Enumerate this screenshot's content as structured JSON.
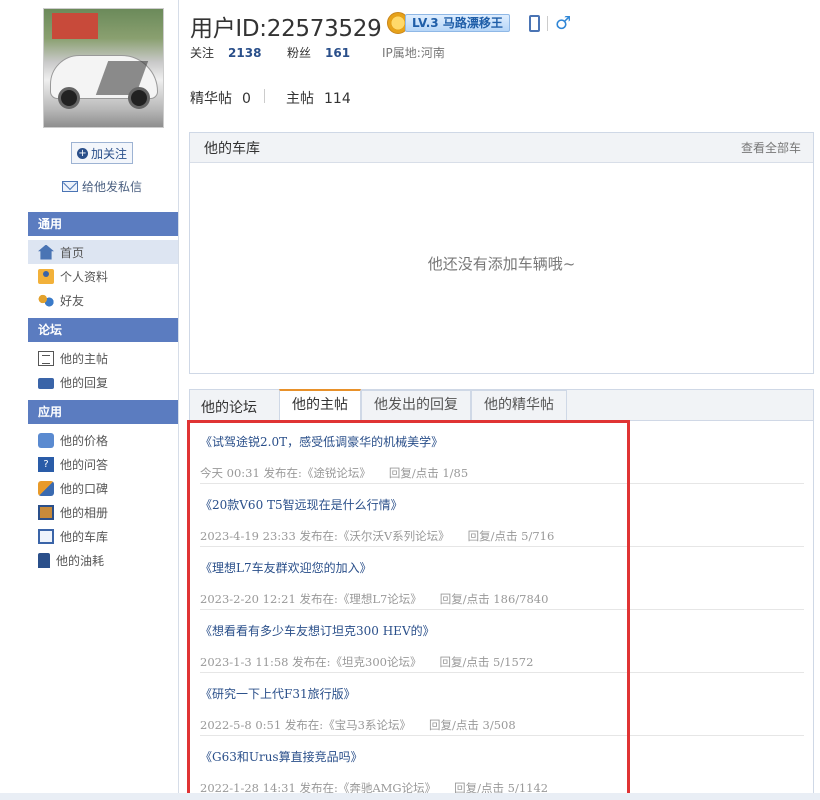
{
  "profile": {
    "title": "用户ID:22573529",
    "level_badge": "LV.3 马路漂移王",
    "follow_label": "关注",
    "follow_count": "2138",
    "fans_label": "粉丝",
    "fans_count": "161",
    "ip_location": "IP属地:河南",
    "essence_label": "精华帖",
    "essence_count": "0",
    "main_label": "主帖",
    "main_count": "114",
    "gender": "male"
  },
  "sidebar": {
    "follow_button": "加关注",
    "message_link": "给他发私信",
    "sections": [
      {
        "title": "通用",
        "items": [
          "首页",
          "个人资料",
          "好友"
        ]
      },
      {
        "title": "论坛",
        "items": [
          "他的主帖",
          "他的回复"
        ]
      },
      {
        "title": "应用",
        "items": [
          "他的价格",
          "他的问答",
          "他的口碑",
          "他的相册",
          "他的车库",
          "他的油耗"
        ]
      }
    ],
    "active_item": "首页"
  },
  "garage": {
    "title": "他的车库",
    "view_all": "查看全部车",
    "empty_text": "他还没有添加车辆哦~"
  },
  "forum": {
    "title": "他的论坛",
    "tabs": [
      "他的主帖",
      "他发出的回复",
      "他的精华帖"
    ],
    "active_tab": "他的主帖",
    "posted_in_label": "发布在:",
    "posts": [
      {
        "title": "《试驾途锐2.0T，感受低调豪华的机械美学》",
        "time": "今天 00:31",
        "board": "《途锐论坛》",
        "stats": "回复/点击 1/85"
      },
      {
        "title": "《20款V60 T5智远现在是什么行情》",
        "time": "2023-4-19 23:33",
        "board": "《沃尔沃V系列论坛》",
        "stats": "回复/点击 5/716"
      },
      {
        "title": "《理想L7车友群欢迎您的加入》",
        "time": "2023-2-20 12:21",
        "board": "《理想L7论坛》",
        "stats": "回复/点击 186/7840"
      },
      {
        "title": "《想看看有多少车友想订坦克300 HEV的》",
        "time": "2023-1-3 11:58",
        "board": "《坦克300论坛》",
        "stats": "回复/点击 5/1572"
      },
      {
        "title": "《研究一下上代F31旅行版》",
        "time": "2022-5-8 0:51",
        "board": "《宝马3系论坛》",
        "stats": "回复/点击 3/508"
      },
      {
        "title": "《G63和Urus算直接竞品吗》",
        "time": "2022-1-28 14:31",
        "board": "《奔驰AMG论坛》",
        "stats": "回复/点击 5/1142"
      }
    ]
  },
  "colors": {
    "nav_header": "#5b7cc0",
    "link_blue": "#2a4f8a",
    "active_tab_accent": "#e8912a",
    "highlight_box": "#e03434"
  }
}
